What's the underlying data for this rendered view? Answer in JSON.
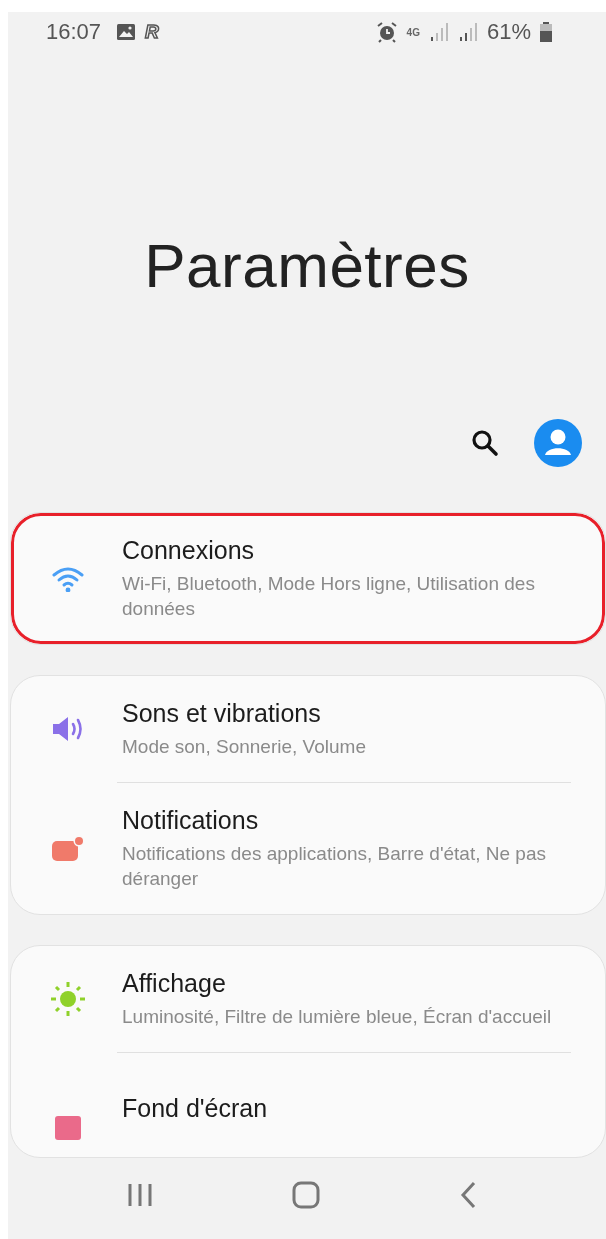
{
  "status_bar": {
    "time": "16:07",
    "app_badge": "R",
    "network": "4G",
    "battery": "61%"
  },
  "header": {
    "title": "Paramètres"
  },
  "groups": [
    {
      "items": [
        {
          "kind": "wifi",
          "title": "Connexions",
          "subtitle": "Wi-Fi, Bluetooth, Mode Hors ligne, Utilisation des données",
          "highlighted": true
        }
      ]
    },
    {
      "items": [
        {
          "kind": "sound",
          "title": "Sons et vibrations",
          "subtitle": "Mode son, Sonnerie, Volume",
          "highlighted": false
        },
        {
          "kind": "notifications",
          "title": "Notifications",
          "subtitle": "Notifications des applications, Barre d'état, Ne pas déranger",
          "highlighted": false
        }
      ]
    },
    {
      "items": [
        {
          "kind": "display",
          "title": "Affichage",
          "subtitle": "Luminosité, Filtre de lumière bleue, Écran d'accueil",
          "highlighted": false
        },
        {
          "kind": "wallpaper",
          "title": "Fond d'écran",
          "highlighted": false
        }
      ]
    }
  ]
}
